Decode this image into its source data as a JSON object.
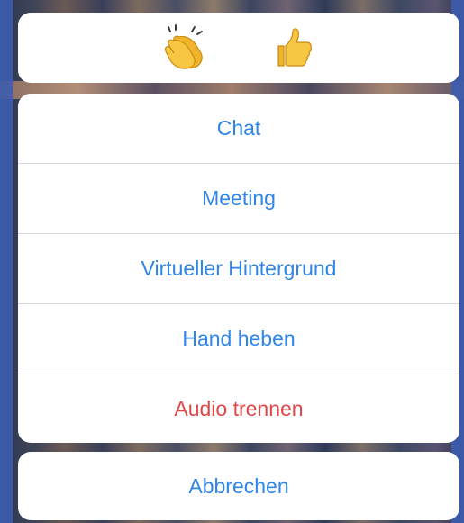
{
  "reactions": [
    {
      "name": "clapping-hands",
      "icon": "clapping-hands-icon"
    },
    {
      "name": "thumbs-up",
      "icon": "thumbs-up-icon"
    }
  ],
  "actions": {
    "chat": "Chat",
    "meeting": "Meeting",
    "virtual_background": "Virtueller Hintergrund",
    "raise_hand": "Hand heben",
    "disconnect_audio": "Audio trennen"
  },
  "cancel": "Abbrechen",
  "colors": {
    "link_blue": "#2f86e8",
    "destructive_red": "#e0484a"
  }
}
